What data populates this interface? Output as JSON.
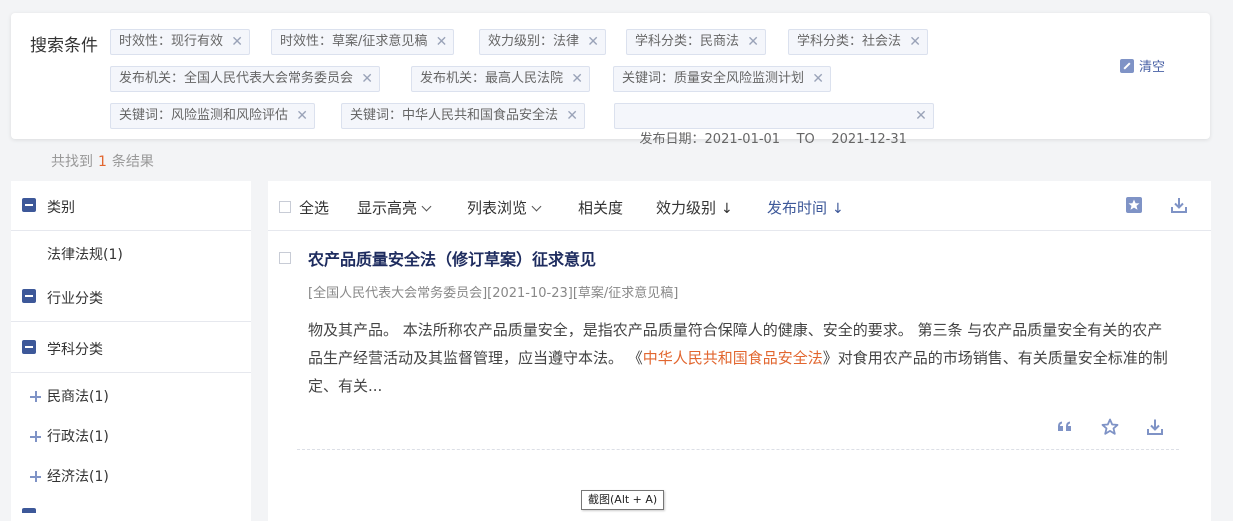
{
  "search": {
    "title": "搜索条件",
    "tags": [
      "时效性：现行有效",
      "时效性：草案/征求意见稿",
      "效力级别：法律",
      "学科分类：民商法",
      "学科分类：社会法",
      "发布机关：全国人民代表大会常务委员会",
      "发布机关：最高人民法院",
      "关键词：质量安全风险监测计划",
      "关键词：风险监测和风险评估",
      "关键词：中华人民共和国食品安全法",
      "发布日期：2021-01-01    TO    2021-12-31"
    ],
    "close_glyph": "✕",
    "clear_label": "清空"
  },
  "result_count": {
    "prefix": "共找到",
    "count": "1",
    "suffix": "条结果"
  },
  "sidebar": {
    "categories": [
      {
        "label": "类别",
        "items": [
          "法律法规(1)"
        ]
      },
      {
        "label": "行业分类",
        "items": []
      },
      {
        "label": "学科分类",
        "items": [
          "民商法(1)",
          "行政法(1)",
          "经济法(1)"
        ]
      }
    ]
  },
  "toolbar": {
    "select_all": "全选",
    "highlight": "显示高亮",
    "list_view": "列表浏览",
    "relevance": "相关度",
    "effect_level": "效力级别",
    "publish_time": "发布时间",
    "sort_arrow": "↓"
  },
  "result": {
    "title": "农产品质量安全法（修订草案）征求意见",
    "meta": "[全国人民代表大会常务委员会][2021-10-23][草案/征求意见稿]",
    "body_before": "物及其产品。 本法所称农产品质量安全，是指农产品质量符合保障人的健康、安全的要求。 第三条 与农产品质量安全有关的农产品生产经营活动及其监督管理，应当遵守本法。 《",
    "body_highlight": "中华人民共和国食品安全法",
    "body_after": "》对食用农产品的市场销售、有关质量安全标准的制定、有关..."
  },
  "tooltip": "截图(Alt + A)",
  "colors": {
    "accent": "#3d5899",
    "highlight": "#e2662f",
    "title": "#1e2c5f"
  }
}
